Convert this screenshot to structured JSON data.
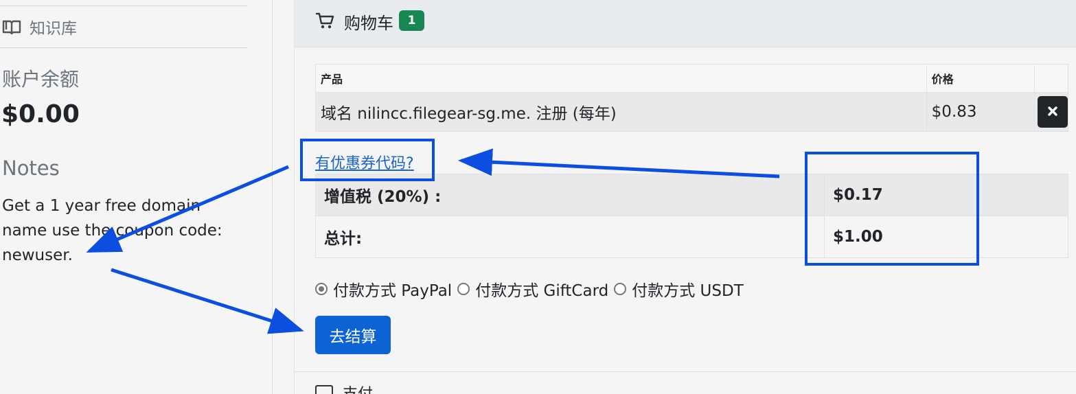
{
  "sidebar": {
    "knowledge_base_label": "知识库",
    "balance_heading": "账户余额",
    "balance_value": "$0.00",
    "notes_heading": "Notes",
    "notes_text": "Get a 1 year free domain name use the coupon code: newuser."
  },
  "cart": {
    "title": "购物车",
    "badge_count": "1",
    "table": {
      "headers": {
        "product": "产品",
        "price": "价格"
      },
      "rows": [
        {
          "product": "域名 nilincc.filegear-sg.me. 注册 (每年)",
          "price": "$0.83"
        }
      ]
    },
    "coupon_link": "有优惠券代码?",
    "totals": [
      {
        "label": "增值税 (20%) :",
        "value": "$0.17"
      },
      {
        "label": "总计:",
        "value": "$1.00"
      }
    ],
    "payment_methods": [
      {
        "label": "付款方式 PayPal",
        "checked": true
      },
      {
        "label": "付款方式 GiftCard",
        "checked": false
      },
      {
        "label": "付款方式 USDT",
        "checked": false
      }
    ],
    "checkout_label": "去结算",
    "next_section_label": "支付"
  },
  "colors": {
    "badge": "#198754",
    "primary_button": "#0d63d4",
    "annotation": "#0b4ee0",
    "link": "#1a66c6"
  }
}
